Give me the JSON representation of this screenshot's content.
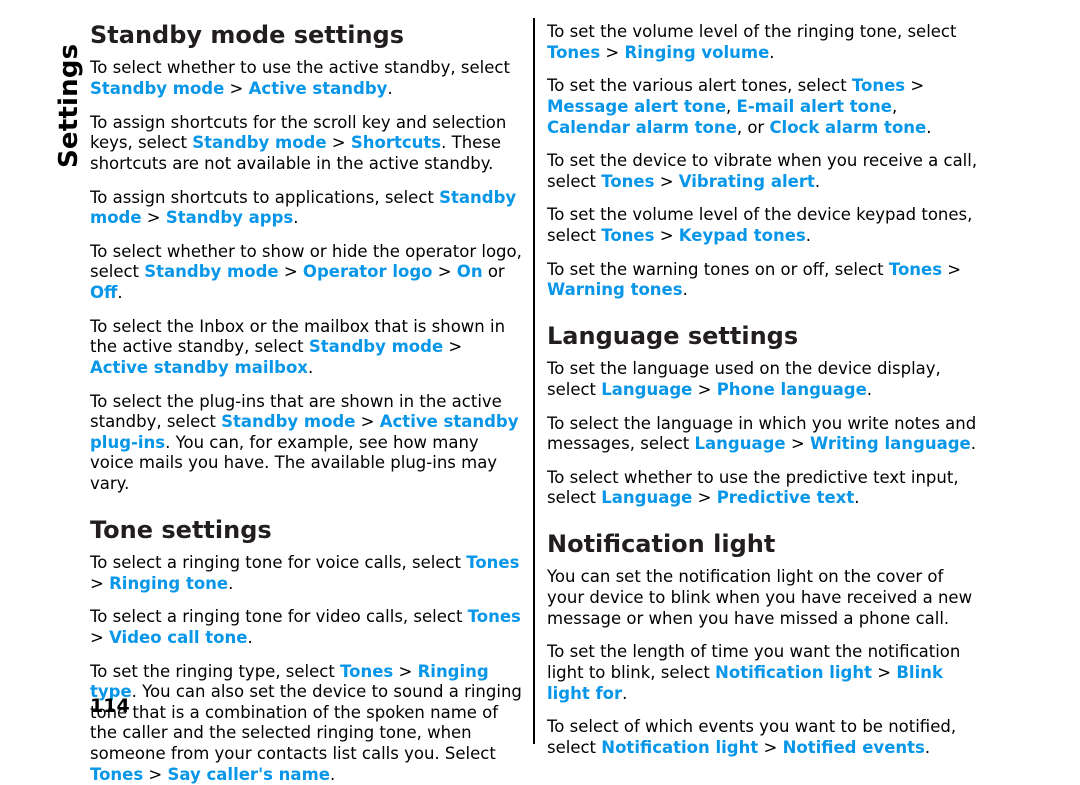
{
  "side_tab": {
    "label": "Settings"
  },
  "page_number": "114",
  "left_column": {
    "sections": [
      {
        "heading": "Standby mode settings",
        "paragraphs": [
          [
            {
              "t": "To select whether to use the active standby, select ",
              "s": "plain"
            },
            {
              "t": "Standby mode",
              "s": "hl"
            },
            {
              "t": " > ",
              "s": "gt"
            },
            {
              "t": "Active standby",
              "s": "hl"
            },
            {
              "t": ".",
              "s": "plain"
            }
          ],
          [
            {
              "t": "To assign shortcuts for the scroll key and selection keys, select ",
              "s": "plain"
            },
            {
              "t": "Standby mode",
              "s": "hl"
            },
            {
              "t": " > ",
              "s": "gt"
            },
            {
              "t": "Shortcuts",
              "s": "hl"
            },
            {
              "t": ". These shortcuts are not available in the active standby.",
              "s": "plain"
            }
          ],
          [
            {
              "t": "To assign shortcuts to applications, select ",
              "s": "plain"
            },
            {
              "t": "Standby mode",
              "s": "hl"
            },
            {
              "t": " > ",
              "s": "gt"
            },
            {
              "t": "Standby apps",
              "s": "hl"
            },
            {
              "t": ".",
              "s": "plain"
            }
          ],
          [
            {
              "t": "To select whether to show or hide the operator logo, select ",
              "s": "plain"
            },
            {
              "t": "Standby mode",
              "s": "hl"
            },
            {
              "t": " > ",
              "s": "gt"
            },
            {
              "t": "Operator logo",
              "s": "hl"
            },
            {
              "t": " > ",
              "s": "gt"
            },
            {
              "t": "On",
              "s": "hl"
            },
            {
              "t": " or ",
              "s": "plain"
            },
            {
              "t": "Off",
              "s": "hl"
            },
            {
              "t": ".",
              "s": "plain"
            }
          ],
          [
            {
              "t": "To select the Inbox or the mailbox that is shown in the active standby, select ",
              "s": "plain"
            },
            {
              "t": "Standby mode",
              "s": "hl"
            },
            {
              "t": " > ",
              "s": "gt"
            },
            {
              "t": "Active standby mailbox",
              "s": "hl"
            },
            {
              "t": ".",
              "s": "plain"
            }
          ],
          [
            {
              "t": "To select the plug-ins that are shown in the active standby, select ",
              "s": "plain"
            },
            {
              "t": "Standby mode",
              "s": "hl"
            },
            {
              "t": " > ",
              "s": "gt"
            },
            {
              "t": "Active standby plug-ins",
              "s": "hl"
            },
            {
              "t": ". You can, for example, see how many voice mails you have. The available plug-ins may vary.",
              "s": "plain"
            }
          ]
        ]
      },
      {
        "heading": "Tone settings",
        "paragraphs": [
          [
            {
              "t": "To select a ringing tone for voice calls, select ",
              "s": "plain"
            },
            {
              "t": "Tones",
              "s": "hl"
            },
            {
              "t": " > ",
              "s": "gt"
            },
            {
              "t": "Ringing tone",
              "s": "hl"
            },
            {
              "t": ".",
              "s": "plain"
            }
          ],
          [
            {
              "t": "To select a ringing tone for video calls, select ",
              "s": "plain"
            },
            {
              "t": "Tones",
              "s": "hl"
            },
            {
              "t": " > ",
              "s": "gt"
            },
            {
              "t": "Video call tone",
              "s": "hl"
            },
            {
              "t": ".",
              "s": "plain"
            }
          ],
          [
            {
              "t": "To set the ringing type, select ",
              "s": "plain"
            },
            {
              "t": "Tones",
              "s": "hl"
            },
            {
              "t": " > ",
              "s": "gt"
            },
            {
              "t": "Ringing type",
              "s": "hl"
            },
            {
              "t": ". You can also set the device to sound a ringing tone that is a combination of the spoken name of the caller and the selected ringing tone, when someone from your contacts list calls you. Select ",
              "s": "plain"
            },
            {
              "t": "Tones",
              "s": "hl"
            },
            {
              "t": " > ",
              "s": "gt"
            },
            {
              "t": "Say caller's name",
              "s": "hl"
            },
            {
              "t": ".",
              "s": "plain"
            }
          ]
        ]
      }
    ]
  },
  "right_column": {
    "sections": [
      {
        "heading": "",
        "paragraphs": [
          [
            {
              "t": "To set the volume level of the ringing tone, select ",
              "s": "plain"
            },
            {
              "t": "Tones",
              "s": "hl"
            },
            {
              "t": " > ",
              "s": "gt"
            },
            {
              "t": "Ringing volume",
              "s": "hl"
            },
            {
              "t": ".",
              "s": "plain"
            }
          ],
          [
            {
              "t": "To set the various alert tones, select ",
              "s": "plain"
            },
            {
              "t": "Tones",
              "s": "hl"
            },
            {
              "t": " > ",
              "s": "gt"
            },
            {
              "t": "Message alert tone",
              "s": "hl"
            },
            {
              "t": ", ",
              "s": "plain"
            },
            {
              "t": "E-mail alert tone",
              "s": "hl"
            },
            {
              "t": ", ",
              "s": "plain"
            },
            {
              "t": "Calendar alarm tone",
              "s": "hl"
            },
            {
              "t": ", or ",
              "s": "plain"
            },
            {
              "t": "Clock alarm tone",
              "s": "hl"
            },
            {
              "t": ".",
              "s": "plain"
            }
          ],
          [
            {
              "t": "To set the device to vibrate when you receive a call, select ",
              "s": "plain"
            },
            {
              "t": "Tones",
              "s": "hl"
            },
            {
              "t": " > ",
              "s": "gt"
            },
            {
              "t": "Vibrating alert",
              "s": "hl"
            },
            {
              "t": ".",
              "s": "plain"
            }
          ],
          [
            {
              "t": "To set the volume level of the device keypad tones, select ",
              "s": "plain"
            },
            {
              "t": "Tones",
              "s": "hl"
            },
            {
              "t": " > ",
              "s": "gt"
            },
            {
              "t": "Keypad tones",
              "s": "hl"
            },
            {
              "t": ".",
              "s": "plain"
            }
          ],
          [
            {
              "t": "To set the warning tones on or off, select ",
              "s": "plain"
            },
            {
              "t": "Tones",
              "s": "hl"
            },
            {
              "t": " > ",
              "s": "gt"
            },
            {
              "t": "Warning tones",
              "s": "hl"
            },
            {
              "t": ".",
              "s": "plain"
            }
          ]
        ]
      },
      {
        "heading": "Language settings",
        "paragraphs": [
          [
            {
              "t": "To set the language used on the device display, select ",
              "s": "plain"
            },
            {
              "t": "Language",
              "s": "hl"
            },
            {
              "t": " > ",
              "s": "gt"
            },
            {
              "t": "Phone language",
              "s": "hl"
            },
            {
              "t": ".",
              "s": "plain"
            }
          ],
          [
            {
              "t": "To select the language in which you write notes and messages, select ",
              "s": "plain"
            },
            {
              "t": "Language",
              "s": "hl"
            },
            {
              "t": " > ",
              "s": "gt"
            },
            {
              "t": "Writing language",
              "s": "hl"
            },
            {
              "t": ".",
              "s": "plain"
            }
          ],
          [
            {
              "t": "To select whether to use the predictive text input, select ",
              "s": "plain"
            },
            {
              "t": "Language",
              "s": "hl"
            },
            {
              "t": " > ",
              "s": "gt"
            },
            {
              "t": "Predictive text",
              "s": "hl"
            },
            {
              "t": ".",
              "s": "plain"
            }
          ]
        ]
      },
      {
        "heading": "Notification light",
        "paragraphs": [
          [
            {
              "t": "You can set the notification light on the cover of your device to blink when you have received a new message or when you have missed a phone call.",
              "s": "plain"
            }
          ],
          [
            {
              "t": "To set the length of time you want the notification light to blink, select ",
              "s": "plain"
            },
            {
              "t": "Notification light",
              "s": "hl"
            },
            {
              "t": " > ",
              "s": "gt"
            },
            {
              "t": "Blink light for",
              "s": "hl"
            },
            {
              "t": ".",
              "s": "plain"
            }
          ],
          [
            {
              "t": "To select of which events you want to be notified, select ",
              "s": "plain"
            },
            {
              "t": "Notification light",
              "s": "hl"
            },
            {
              "t": " > ",
              "s": "gt"
            },
            {
              "t": "Notified events",
              "s": "hl"
            },
            {
              "t": ".",
              "s": "plain"
            }
          ]
        ]
      }
    ]
  },
  "colors": {
    "link": "#0896e8",
    "text": "#000000"
  }
}
